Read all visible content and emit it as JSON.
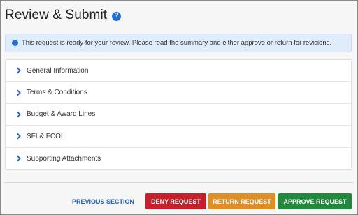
{
  "header": {
    "title": "Review & Submit",
    "help_icon": "question-circle-icon",
    "help_glyph": "?"
  },
  "banner": {
    "icon": "info-circle-icon",
    "icon_glyph": "i",
    "text": "This request is ready for your review. Please read the summary and either approve or return for revisions."
  },
  "sections": [
    {
      "label": "General Information"
    },
    {
      "label": "Terms & Conditions"
    },
    {
      "label": "Budget & Award Lines"
    },
    {
      "label": "SFI & FCOI"
    },
    {
      "label": "Supporting Attachments"
    }
  ],
  "footer": {
    "previous_label": "PREVIOUS SECTION",
    "deny_label": "DENY REQUEST",
    "return_label": "RETURN REQUEST",
    "approve_label": "APPROVE REQUEST"
  },
  "colors": {
    "accent_blue": "#1d6fd6",
    "deny": "#c8202a",
    "return": "#df8e24",
    "approve": "#1f8a3c",
    "banner_bg": "#dfecfb"
  }
}
